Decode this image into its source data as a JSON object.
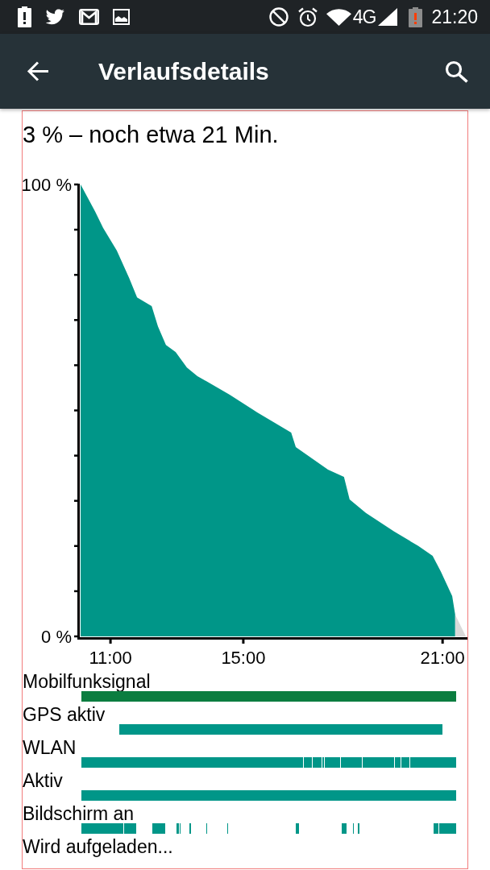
{
  "status_bar": {
    "network_type": "4G",
    "time": "21:20"
  },
  "app_bar": {
    "title": "Verlaufsdetails"
  },
  "summary": "3 % – noch etwa 21 Min.",
  "battery_chart": {
    "chart_data": {
      "type": "area",
      "x": [
        10.1,
        10.54,
        10.78,
        11.19,
        11.56,
        11.8,
        12.24,
        12.43,
        12.67,
        12.96,
        13.3,
        13.62,
        14.59,
        15.41,
        16.44,
        16.58,
        17.55,
        18.03,
        18.2,
        18.69,
        19.54,
        20.27,
        20.7,
        20.95,
        21.29,
        21.38,
        21.7
      ],
      "series": [
        {
          "color": "#009688",
          "values": [
            100,
            94,
            90.4,
            85.4,
            79.3,
            75,
            73.1,
            68.6,
            64.5,
            62.9,
            59.5,
            57.6,
            53.5,
            49.6,
            45.1,
            41.9,
            36.9,
            35.3,
            30.3,
            27.3,
            23.2,
            20,
            17.8,
            14.3,
            8.9,
            4.8,
            null
          ]
        },
        {
          "color": "#d9d9d9",
          "values": [
            null,
            null,
            null,
            null,
            null,
            null,
            null,
            null,
            null,
            null,
            null,
            null,
            null,
            null,
            null,
            null,
            null,
            null,
            null,
            null,
            null,
            null,
            null,
            null,
            null,
            4.8,
            0
          ]
        }
      ],
      "xlim": [
        10.1,
        21.7
      ],
      "ylim": [
        0,
        100
      ],
      "xticks": [
        {
          "value": 11,
          "label": "11:00"
        },
        {
          "value": 15,
          "label": "15:00"
        },
        {
          "value": 21,
          "label": "21:00"
        }
      ],
      "yticks": [
        {
          "value": 0,
          "label": "0 %"
        },
        {
          "value": 100,
          "label": "100 %"
        }
      ]
    }
  },
  "timelines": [
    {
      "label": "Mobilfunksignal",
      "color": "#0b7d40"
    },
    {
      "label": "GPS aktiv",
      "color": "#009688"
    },
    {
      "label": "WLAN",
      "color": "#009688"
    },
    {
      "label": "Aktiv",
      "color": "#009688"
    },
    {
      "label": "Bildschirm an",
      "color": "#009688"
    },
    {
      "label": "Wird aufgeladen..."
    }
  ]
}
